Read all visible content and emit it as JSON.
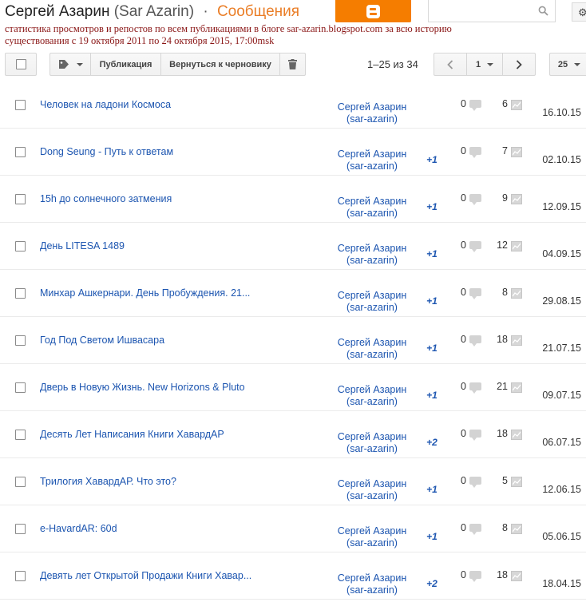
{
  "header": {
    "title": "Сергей Азарин",
    "subtitle": "(Sar Azarin)",
    "separator": "·",
    "section": "Сообщения",
    "annotation": "статистика просмотров и репостов по всем публикациями в блоге sar-azarin.blogspot.com за всю историю существования с 19 октября 2011 по 24 октября 2015, 17:00msk",
    "search": {
      "value": "",
      "placeholder": ""
    }
  },
  "toolbar": {
    "publish_label": "Публикация",
    "revert_label": "Вернуться к черновику",
    "pagination": "1–25 из 34",
    "page": "1",
    "per_page": "25"
  },
  "posts": [
    {
      "title": "Человек на ладони Космоса",
      "author_name": "Сергей Азарин",
      "author_handle": "(sar-azarin)",
      "plus": "",
      "comments": "0",
      "views": "6",
      "date": "16.10.15"
    },
    {
      "title": "Dong Seung - Путь к ответам",
      "author_name": "Сергей Азарин",
      "author_handle": "(sar-azarin)",
      "plus": "+1",
      "comments": "0",
      "views": "7",
      "date": "02.10.15"
    },
    {
      "title": "15h до солнечного затмения",
      "author_name": "Сергей Азарин",
      "author_handle": "(sar-azarin)",
      "plus": "+1",
      "comments": "0",
      "views": "9",
      "date": "12.09.15"
    },
    {
      "title": "День LITESA 1489",
      "author_name": "Сергей Азарин",
      "author_handle": "(sar-azarin)",
      "plus": "+1",
      "comments": "0",
      "views": "12",
      "date": "04.09.15"
    },
    {
      "title": "Минхар Ашкернари. День Пробуждения. 21...",
      "author_name": "Сергей Азарин",
      "author_handle": "(sar-azarin)",
      "plus": "+1",
      "comments": "0",
      "views": "8",
      "date": "29.08.15"
    },
    {
      "title": "Год Под Светом Ишвасара",
      "author_name": "Сергей Азарин",
      "author_handle": "(sar-azarin)",
      "plus": "+1",
      "comments": "0",
      "views": "18",
      "date": "21.07.15"
    },
    {
      "title": "Дверь в Новую Жизнь. New Horizons & Pluto",
      "author_name": "Сергей Азарин",
      "author_handle": "(sar-azarin)",
      "plus": "+1",
      "comments": "0",
      "views": "21",
      "date": "09.07.15"
    },
    {
      "title": "Десять Лет Написания Книги ХавардАР",
      "author_name": "Сергей Азарин",
      "author_handle": "(sar-azarin)",
      "plus": "+2",
      "comments": "0",
      "views": "18",
      "date": "06.07.15"
    },
    {
      "title": "Трилогия ХавардАР. Что это?",
      "author_name": "Сергей Азарин",
      "author_handle": "(sar-azarin)",
      "plus": "+1",
      "comments": "0",
      "views": "5",
      "date": "12.06.15"
    },
    {
      "title": "e-HavardAR: 60d",
      "author_name": "Сергей Азарин",
      "author_handle": "(sar-azarin)",
      "plus": "+1",
      "comments": "0",
      "views": "8",
      "date": "05.06.15"
    },
    {
      "title": "Девять лет Открытой Продажи Книги Хавар...",
      "author_name": "Сергей Азарин",
      "author_handle": "(sar-azarin)",
      "plus": "+2",
      "comments": "0",
      "views": "18",
      "date": "18.04.15"
    }
  ],
  "icons": {
    "blogger": "blogger-logo-icon",
    "search": "search-icon",
    "settings": "gear-icon",
    "label": "label-tag-icon",
    "delete": "trash-icon",
    "prev": "chevron-left-icon",
    "next": "chevron-right-icon",
    "comments": "comment-bubble-icon",
    "views": "views-chart-icon"
  },
  "colors": {
    "section_accent": "#ea7e27",
    "blogger_orange": "#f57d00",
    "link_blue": "#1c55b0",
    "annotation_red": "#8a1616"
  }
}
